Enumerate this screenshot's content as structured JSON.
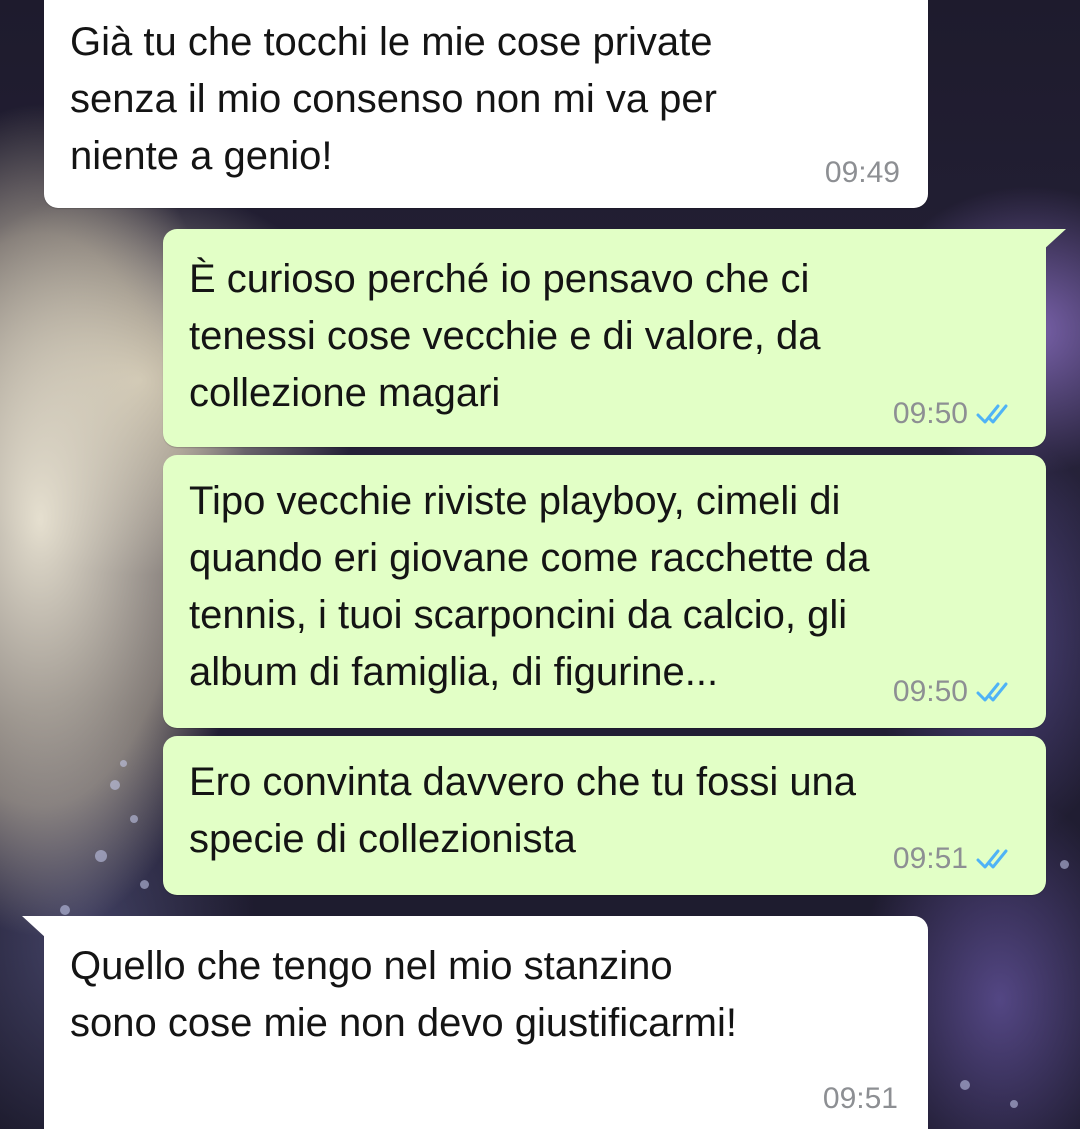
{
  "chat": {
    "messages": [
      {
        "direction": "incoming",
        "text": "Già tu che tocchi le mie cose private\nsenza il mio consenso non mi va per\nniente a genio!",
        "time": "09:49"
      },
      {
        "direction": "outgoing",
        "text": "È curioso perché io pensavo che ci\ntenessi cose vecchie e di valore, da\ncollezione magari",
        "time": "09:50",
        "status_icon": "double-check-read-icon"
      },
      {
        "direction": "outgoing",
        "text": "Tipo vecchie riviste playboy, cimeli di\nquando eri giovane come racchette da\ntennis, i tuoi scarponcini da calcio, gli\nalbum di famiglia, di figurine...",
        "time": "09:50",
        "status_icon": "double-check-read-icon"
      },
      {
        "direction": "outgoing",
        "text": "Ero convinta davvero che tu fossi una\nspecie di collezionista",
        "time": "09:51",
        "status_icon": "double-check-read-icon"
      },
      {
        "direction": "incoming",
        "text": "Quello che tengo nel mio stanzino\nsono cose mie non devo giustificarmi!",
        "time": "09:51"
      }
    ]
  },
  "colors": {
    "incoming_bubble": "#ffffff",
    "outgoing_bubble": "#e2ffc6",
    "timestamp": "#8d8f93",
    "read_ticks": "#4fb3f6"
  }
}
